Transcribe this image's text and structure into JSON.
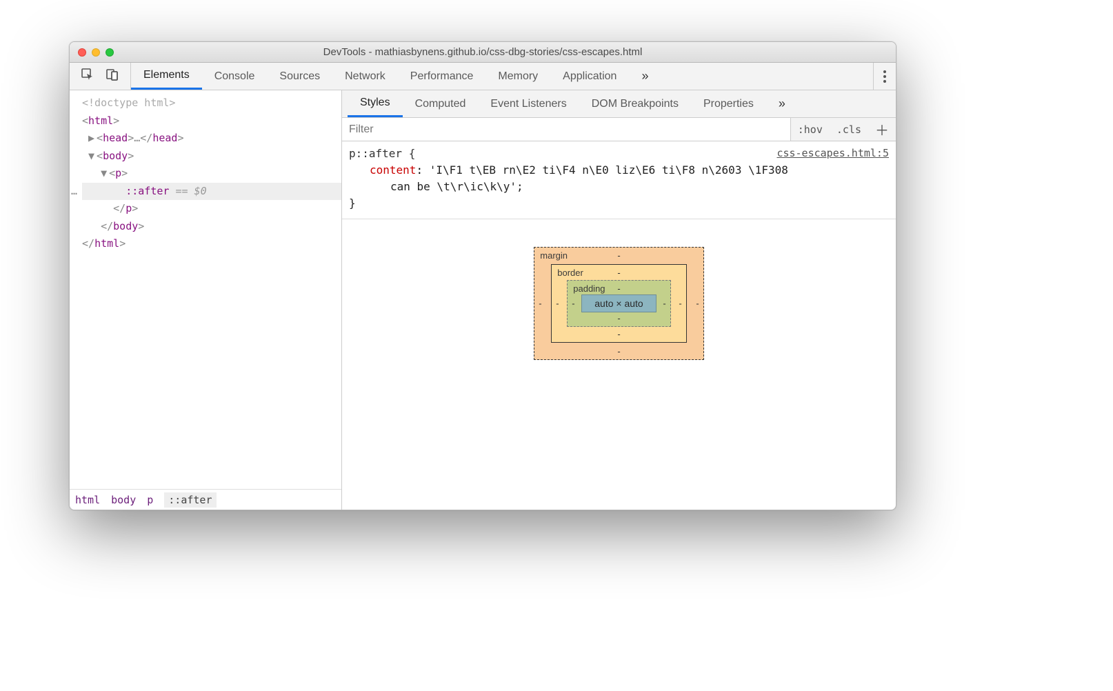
{
  "window": {
    "title": "DevTools - mathiasbynens.github.io/css-dbg-stories/css-escapes.html"
  },
  "main_tabs": {
    "items": [
      "Elements",
      "Console",
      "Sources",
      "Network",
      "Performance",
      "Memory",
      "Application"
    ],
    "more_glyph": "»"
  },
  "dom": {
    "doctype": "<!doctype html>",
    "html_open": "html",
    "head": "head",
    "head_ellipsis": "…",
    "body": "body",
    "p": "p",
    "after": "::after",
    "equals_zero": " == $0",
    "p_close": "p",
    "body_close": "body",
    "html_close": "html"
  },
  "breadcrumb": [
    "html",
    "body",
    "p",
    "::after"
  ],
  "styles_tabs": {
    "items": [
      "Styles",
      "Computed",
      "Event Listeners",
      "DOM Breakpoints",
      "Properties"
    ],
    "more_glyph": "»"
  },
  "filter": {
    "placeholder": "Filter",
    "hov": ":hov",
    "cls": ".cls",
    "plus": "＋"
  },
  "rule": {
    "selector": "p::after {",
    "source": "css-escapes.html:5",
    "prop": "content",
    "colon": ": ",
    "value_line1": "'I\\F1 t\\EB rn\\E2 ti\\F4 n\\E0 liz\\E6 ti\\F8 n\\2603 \\1F308",
    "value_line2": "can be \\t\\r\\ic\\k\\y';",
    "close": "}"
  },
  "box_model": {
    "margin_label": "margin",
    "border_label": "border",
    "padding_label": "padding",
    "dash": "-",
    "content": "auto × auto"
  }
}
